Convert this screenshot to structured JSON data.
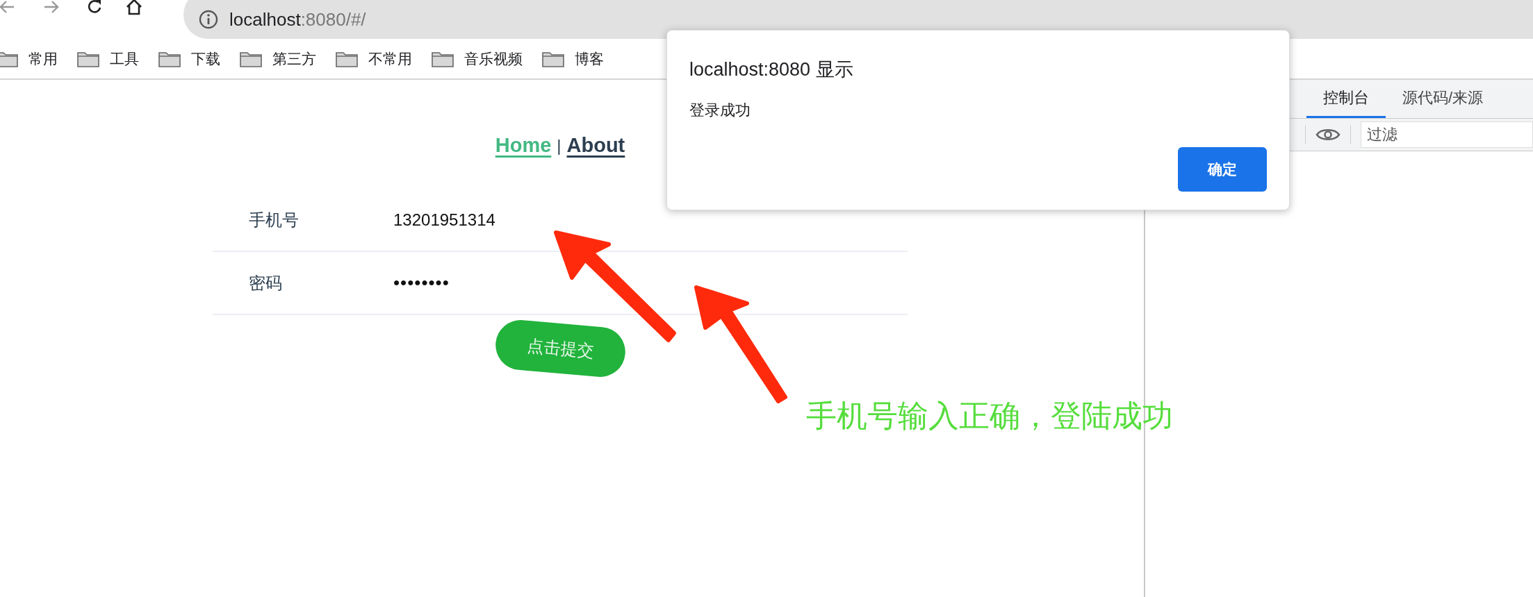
{
  "browser": {
    "address": {
      "host": "localhost",
      "rest": ":8080/#/"
    },
    "bookmarks": [
      "常用",
      "工具",
      "下载",
      "第三方",
      "不常用",
      "音乐视频",
      "博客"
    ]
  },
  "page": {
    "nav": [
      {
        "label": "Home",
        "selected": true
      },
      {
        "label": "About",
        "selected": false
      }
    ],
    "nav_separator": "|",
    "form": [
      {
        "kind": "text",
        "label": "手机号",
        "value": "13201951314"
      },
      {
        "kind": "password",
        "label": "密码",
        "value": "••••••••"
      }
    ],
    "submit": "点击提交"
  },
  "devtools": {
    "tabs": [
      {
        "label": "控制台",
        "selected": true
      },
      {
        "label": "源代码/来源",
        "selected": false
      }
    ],
    "filter": {
      "placeholder": "过滤"
    }
  },
  "dialog": {
    "title": "localhost:8080 显示",
    "message": "登录成功",
    "button": "确定"
  },
  "annotation": "手机号输入正确，登陆成功"
}
